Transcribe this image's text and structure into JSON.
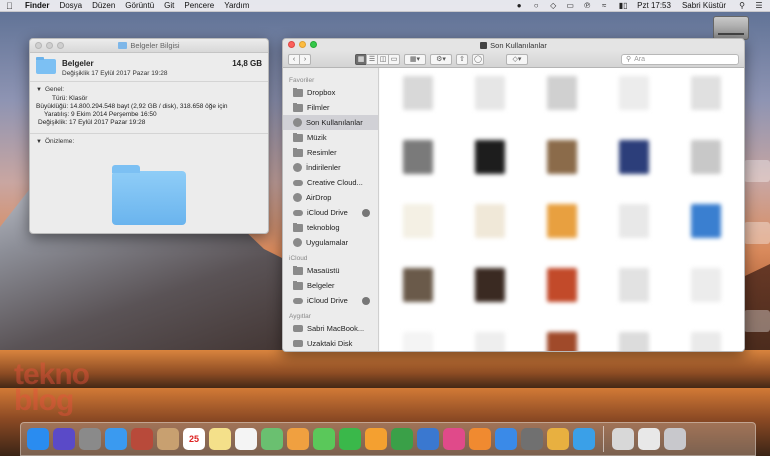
{
  "menubar": {
    "app": "Finder",
    "items": [
      "Dosya",
      "Düzen",
      "Görüntü",
      "Git",
      "Pencere",
      "Yardım"
    ],
    "clock": "Pzt 17:53",
    "user": "Sabri Küstür"
  },
  "info_window": {
    "title": "Belgeler Bilgisi",
    "name": "Belgeler",
    "modified": "Değişiklik 17 Eylül 2017 Pazar 19:28",
    "size": "14,8 GB",
    "general_header": "Genel:",
    "details": [
      "Türü: Klasör",
      "Büyüklüğü: 14.800.294.548 bayt (2,92 GB / disk), 318.658 öğe için",
      "Yaratılış: 9 Ekim 2014 Perşembe 16:50",
      "Değişiklik: 17 Eylül 2017 Pazar 19:28"
    ],
    "preview_header": "Önizleme:"
  },
  "finder": {
    "title": "Son Kullanılanlar",
    "search_placeholder": "Ara",
    "sidebar": {
      "sections": [
        {
          "header": "Favoriler",
          "items": [
            {
              "label": "Dropbox",
              "icon": "folder-icon"
            },
            {
              "label": "Filmler",
              "icon": "folder-icon"
            },
            {
              "label": "Son Kullanılanlar",
              "icon": "clock-icon",
              "selected": true
            },
            {
              "label": "Müzik",
              "icon": "music-icon"
            },
            {
              "label": "Resimler",
              "icon": "camera-icon"
            },
            {
              "label": "İndirilenler",
              "icon": "download-icon"
            },
            {
              "label": "Creative Cloud...",
              "icon": "cloud-icon"
            },
            {
              "label": "AirDrop",
              "icon": "airdrop-icon"
            },
            {
              "label": "iCloud Drive",
              "icon": "cloud-icon",
              "badge": true
            },
            {
              "label": "teknoblog",
              "icon": "folder-icon"
            },
            {
              "label": "Uygulamalar",
              "icon": "apps-icon"
            }
          ]
        },
        {
          "header": "iCloud",
          "items": [
            {
              "label": "Masaüstü",
              "icon": "folder-icon"
            },
            {
              "label": "Belgeler",
              "icon": "folder-icon"
            },
            {
              "label": "iCloud Drive",
              "icon": "cloud-icon",
              "badge": true
            }
          ]
        },
        {
          "header": "Aygıtlar",
          "items": [
            {
              "label": "Sabri MacBook...",
              "icon": "laptop-icon"
            },
            {
              "label": "Uzaktaki Disk",
              "icon": "disk-icon"
            }
          ]
        }
      ]
    },
    "files": [
      {
        "name": "",
        "color": "#d8d8d8"
      },
      {
        "name": "",
        "color": "#e6e6e6"
      },
      {
        "name": "",
        "color": "#d0d0d0"
      },
      {
        "name": "",
        "color": "#ececec"
      },
      {
        "name": "",
        "color": "#e0e0e0"
      },
      {
        "name": "",
        "color": "#eaeaea"
      },
      {
        "name": "",
        "color": "#7a7a7a"
      },
      {
        "name": "",
        "color": "#1d1d1d"
      },
      {
        "name": "",
        "color": "#8b6b4a"
      },
      {
        "name": "",
        "color": "#2c3e7a"
      },
      {
        "name": "",
        "color": "#c8c8c8"
      },
      {
        "name": "",
        "color": "#ededed"
      },
      {
        "name": "",
        "color": "#f4f0e4"
      },
      {
        "name": "",
        "color": "#f0e8d8"
      },
      {
        "name": "",
        "color": "#e8a040"
      },
      {
        "name": "",
        "color": "#e8e8e8"
      },
      {
        "name": "",
        "color": "#3a7fd0"
      },
      {
        "name": "",
        "color": "#f0f0f0"
      },
      {
        "name": "",
        "color": "#6a5a4a"
      },
      {
        "name": "",
        "color": "#3a2a22"
      },
      {
        "name": "",
        "color": "#c24a2a"
      },
      {
        "name": "",
        "color": "#e2e2e2"
      },
      {
        "name": "",
        "color": "#ececec"
      },
      {
        "name": "",
        "color": "#f2f2f2"
      },
      {
        "name": "",
        "color": "#f4f4f4"
      },
      {
        "name": "",
        "color": "#eeeeee"
      },
      {
        "name": "",
        "color": "#a04a2a"
      },
      {
        "name": "",
        "color": "#dcdcdc"
      },
      {
        "name": "",
        "color": "#eaeaea"
      },
      {
        "name": "",
        "color": "#f2f2f2"
      }
    ]
  },
  "dock": {
    "calendar_day": "25",
    "apps": [
      {
        "name": "finder-icon",
        "color": "#2a8cf0"
      },
      {
        "name": "siri-icon",
        "color": "#5a4ac8"
      },
      {
        "name": "launchpad-icon",
        "color": "#8a8a8a"
      },
      {
        "name": "safari-icon",
        "color": "#3a9af0"
      },
      {
        "name": "photo-booth-icon",
        "color": "#b84a3a"
      },
      {
        "name": "contacts-icon",
        "color": "#c8a070"
      },
      {
        "name": "calendar-icon",
        "color": "#ffffff"
      },
      {
        "name": "notes-icon",
        "color": "#f4e08a"
      },
      {
        "name": "reminders-icon",
        "color": "#f4f4f4"
      },
      {
        "name": "maps-icon",
        "color": "#6ac070"
      },
      {
        "name": "photos-icon",
        "color": "#f0a040"
      },
      {
        "name": "messages-icon",
        "color": "#5ac85a"
      },
      {
        "name": "facetime-icon",
        "color": "#3ab84a"
      },
      {
        "name": "pages-icon",
        "color": "#f4a030"
      },
      {
        "name": "numbers-icon",
        "color": "#3aa048"
      },
      {
        "name": "keynote-icon",
        "color": "#3a78d0"
      },
      {
        "name": "itunes-icon",
        "color": "#e04a8a"
      },
      {
        "name": "ibooks-icon",
        "color": "#f08a30"
      },
      {
        "name": "app-store-icon",
        "color": "#3a8ae8"
      },
      {
        "name": "system-preferences-icon",
        "color": "#707070"
      },
      {
        "name": "chrome-icon",
        "color": "#e8b040"
      },
      {
        "name": "twitter-icon",
        "color": "#3aa0e8"
      },
      {
        "name": "downloads-stack-icon",
        "color": "#d8d8d8"
      },
      {
        "name": "documents-stack-icon",
        "color": "#e8e8e8"
      },
      {
        "name": "trash-icon",
        "color": "#c8c8cc"
      }
    ]
  },
  "watermark": "tekno\nblog"
}
